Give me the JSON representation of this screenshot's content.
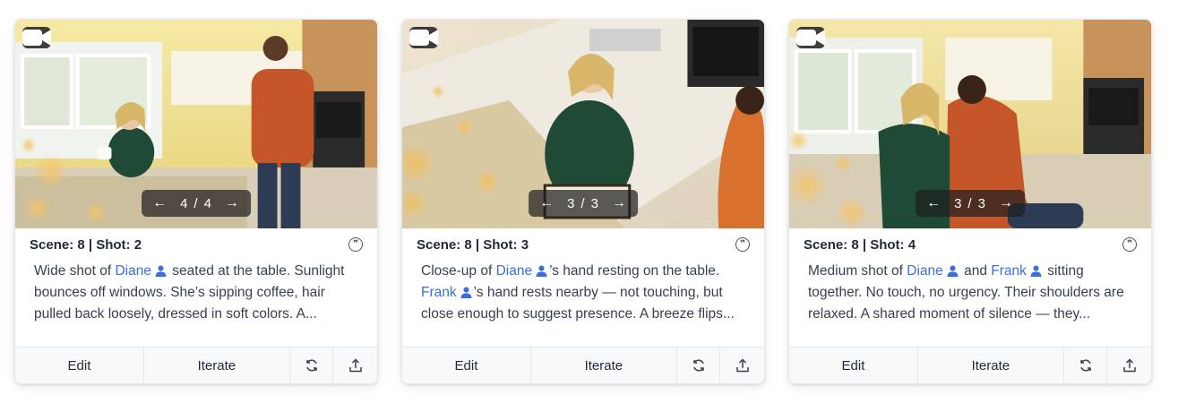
{
  "cards": [
    {
      "pager": {
        "current": "4",
        "sep": "/",
        "total": "4",
        "prev": "←",
        "next": "→"
      },
      "scene_label": "Scene: 8 | Shot: 2",
      "desc": {
        "a": "Wide shot of ",
        "name1": "Diane",
        "b": " seated at the table. Sunlight bounces off windows. She’s sipping coffee, hair pulled back loosely, dressed in soft colors. A..."
      },
      "actions": {
        "edit": "Edit",
        "iterate": "Iterate"
      }
    },
    {
      "pager": {
        "current": "3",
        "sep": "/",
        "total": "3",
        "prev": "←",
        "next": "→"
      },
      "scene_label": "Scene: 8 | Shot: 3",
      "desc": {
        "a": "Close-up of ",
        "name1": "Diane",
        "b": "’s hand resting on the table. ",
        "name2": "Frank",
        "c": "’s hand rests nearby — not touching, but close enough to suggest presence. A breeze flips..."
      },
      "actions": {
        "edit": "Edit",
        "iterate": "Iterate"
      }
    },
    {
      "pager": {
        "current": "3",
        "sep": "/",
        "total": "3",
        "prev": "←",
        "next": "→"
      },
      "scene_label": "Scene: 8 | Shot: 4",
      "desc": {
        "a": "Medium shot of ",
        "name1": "Diane",
        "b": " and ",
        "name2": "Frank",
        "c": " sitting together. No touch, no urgency. Their shoulders are relaxed. A shared moment of silence — they..."
      },
      "actions": {
        "edit": "Edit",
        "iterate": "Iterate"
      }
    }
  ],
  "icons": {
    "camera": "video-camera-icon",
    "quote": "quote-icon",
    "person": "person-icon",
    "refresh": "refresh-icon",
    "share": "share-icon"
  },
  "colors": {
    "name_link": "#3b6fd8",
    "kitchen_wall": "#f2e08a",
    "cabinet_wood": "#c8935a",
    "shirt_orange": "#c4562a",
    "dress_green": "#1f4a35"
  }
}
